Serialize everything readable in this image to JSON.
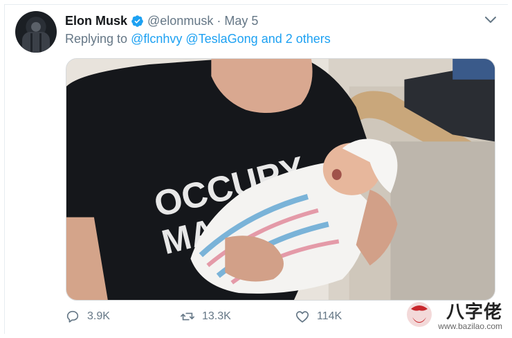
{
  "tweet": {
    "author_name": "Elon Musk",
    "handle": "@elonmusk",
    "separator": "·",
    "date": "May 5",
    "replying_prefix": "Replying to",
    "mention_1": "@flcnhvy",
    "mention_2": "@TeslaGong",
    "mention_more": "and 2 others"
  },
  "photo": {
    "shirt_line_1": "OCCUPY",
    "shirt_line_2": "MARS"
  },
  "actions": {
    "replies": "3.9K",
    "retweets": "13.3K",
    "likes": "114K"
  },
  "watermark": {
    "text": "八字佬",
    "url": "www.bazilao.com"
  },
  "colors": {
    "accent": "#1da1f2",
    "muted": "#657786",
    "text": "#14171a"
  }
}
